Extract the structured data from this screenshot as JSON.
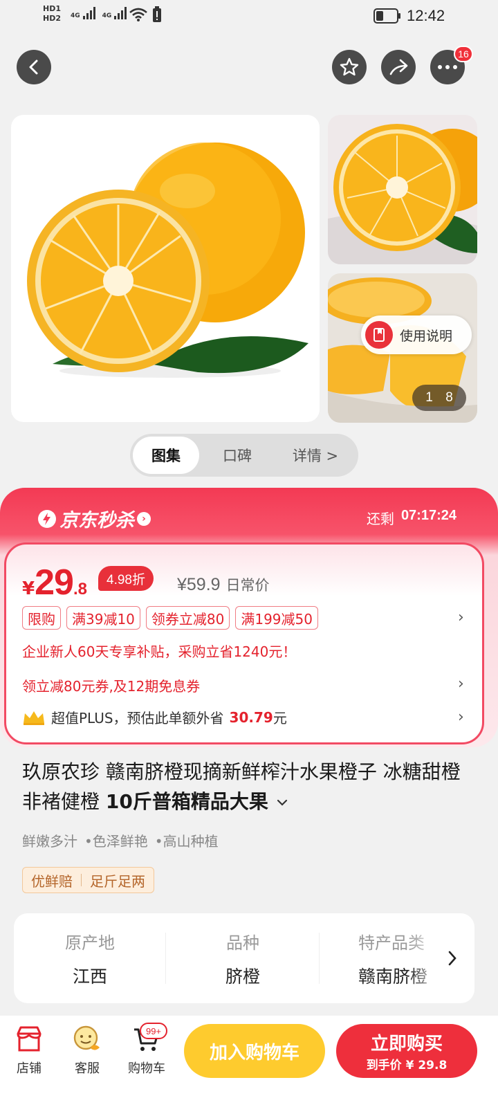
{
  "status_bar": {
    "hd1": "HD1",
    "hd2": "HD2",
    "net1": "4G",
    "net2": "4G",
    "time": "12:42"
  },
  "top_nav": {
    "back_icon": "chevron-left-icon",
    "favorite_icon": "star-icon",
    "share_icon": "share-icon",
    "more_icon": "more-dots-icon",
    "more_badge": "16"
  },
  "gallery": {
    "usage_guide_label": "使用说明",
    "counter_current": "1",
    "counter_total": "8"
  },
  "tabs": [
    {
      "label": "图集",
      "active": true
    },
    {
      "label": "口碑",
      "active": false
    },
    {
      "label": "详情 >",
      "active": false
    }
  ],
  "seckill": {
    "title": "京东秒杀",
    "remaining_label": "还剩",
    "countdown": "07:17:24",
    "accent_color": "#f33a54"
  },
  "price": {
    "currency": "¥",
    "integer": "29",
    "decimal": ".8",
    "discount": "4.98折",
    "original": "¥59.9",
    "original_label": "日常价"
  },
  "promos": [
    "限购",
    "满39减10",
    "领券立减80",
    "满199减50"
  ],
  "enterprise_note": "企业新人60天专享补贴，采购立省1240元！",
  "coupon_note": "领立减80元券,及12期免息券",
  "plus": {
    "prefix": "超值PLUS，预估此单额外省",
    "amount": "30.79",
    "suffix": "元"
  },
  "product": {
    "title_part1": "玖原农珍 赣南脐橙现摘新鲜榨汁水果橙子 冰糖甜橙非褚健橙 ",
    "title_part2": "10斤普箱精品大果",
    "features": [
      "鲜嫩多汁",
      "•色泽鲜艳",
      "•高山种植"
    ],
    "service_tags": [
      "优鲜赔",
      "足斤足两"
    ]
  },
  "attributes": [
    {
      "key": "原产地",
      "value": "江西"
    },
    {
      "key": "品种",
      "value": "脐橙"
    },
    {
      "key": "特产品类",
      "value": "赣南脐橙"
    }
  ],
  "bottom_bar": {
    "store_label": "店铺",
    "service_label": "客服",
    "cart_label": "购物车",
    "cart_badge": "99+",
    "add_to_cart": "加入购物车",
    "buy_now": "立即购买",
    "final_price": "到手价 ¥ 29.8"
  }
}
